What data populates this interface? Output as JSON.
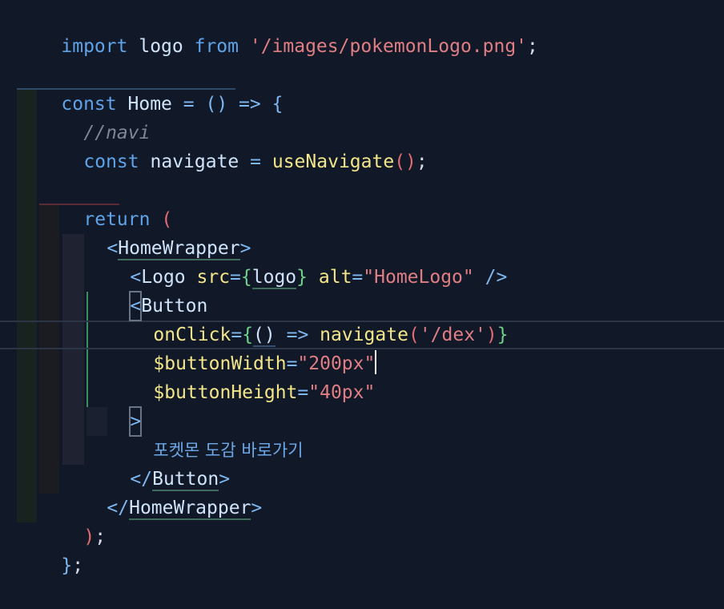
{
  "code": {
    "lines": [
      {
        "tokens": [
          [
            "kw",
            "import"
          ],
          [
            "plain",
            " "
          ],
          [
            "var",
            "logo"
          ],
          [
            "plain",
            " "
          ],
          [
            "kw",
            "from"
          ],
          [
            "plain",
            " "
          ],
          [
            "str",
            "'/images/pokemonLogo.png'"
          ],
          [
            "plain",
            ";"
          ]
        ]
      },
      {
        "tokens": [
          [
            "kw",
            "const"
          ],
          [
            "plain",
            " "
          ],
          [
            "var",
            "Home"
          ],
          [
            "plain",
            " "
          ],
          [
            "op",
            "="
          ],
          [
            "plain",
            " "
          ],
          [
            "paren",
            "()"
          ],
          [
            "plain",
            " "
          ],
          [
            "op",
            "=>"
          ],
          [
            "plain",
            " "
          ],
          [
            "brace",
            "{"
          ]
        ]
      },
      {
        "tokens": [
          [
            "comment",
            "//navi"
          ]
        ]
      },
      {
        "tokens": [
          [
            "kw",
            "const"
          ],
          [
            "plain",
            " "
          ],
          [
            "var",
            "navigate"
          ],
          [
            "plain",
            " "
          ],
          [
            "op",
            "="
          ],
          [
            "plain",
            " "
          ],
          [
            "fn",
            "useNavigate"
          ],
          [
            "paren",
            "()"
          ],
          [
            "plain",
            ";"
          ]
        ]
      },
      {
        "tokens": [
          [
            "kw",
            "return"
          ],
          [
            "plain",
            " "
          ],
          [
            "paren",
            "("
          ]
        ]
      },
      {
        "tokens": [
          [
            "punct",
            "<"
          ],
          [
            "tag",
            "HomeWrapper"
          ],
          [
            "punct",
            ">"
          ]
        ]
      },
      {
        "tokens": [
          [
            "punct",
            "<"
          ],
          [
            "tag",
            "Logo"
          ],
          [
            "plain",
            " "
          ],
          [
            "attr",
            "src"
          ],
          [
            "op",
            "="
          ],
          [
            "brace",
            "{"
          ],
          [
            "var",
            "logo"
          ],
          [
            "brace",
            "}"
          ],
          [
            "plain",
            " "
          ],
          [
            "attr",
            "alt"
          ],
          [
            "op",
            "="
          ],
          [
            "str",
            "\"HomeLogo\""
          ],
          [
            "plain",
            " "
          ],
          [
            "punct",
            "/>"
          ]
        ]
      },
      {
        "tokens": [
          [
            "punct",
            "<"
          ],
          [
            "tag",
            "Button"
          ]
        ]
      },
      {
        "tokens": [
          [
            "attr",
            "onClick"
          ],
          [
            "op",
            "="
          ],
          [
            "brace",
            "{"
          ],
          [
            "paren",
            "()"
          ],
          [
            "plain",
            " "
          ],
          [
            "op",
            "=>"
          ],
          [
            "plain",
            " "
          ],
          [
            "fn",
            "navigate"
          ],
          [
            "paren",
            "("
          ],
          [
            "str",
            "'/dex'"
          ],
          [
            "paren",
            ")"
          ],
          [
            "brace",
            "}"
          ]
        ]
      },
      {
        "tokens": [
          [
            "attr",
            "$buttonWidth"
          ],
          [
            "op",
            "="
          ],
          [
            "str",
            "\"200px\""
          ]
        ]
      },
      {
        "tokens": [
          [
            "attr",
            "$buttonHeight"
          ],
          [
            "op",
            "="
          ],
          [
            "str",
            "\"40px\""
          ]
        ]
      },
      {
        "tokens": [
          [
            "punct",
            ">"
          ]
        ]
      },
      {
        "tokens": [
          [
            "korean",
            "포켓몬 도감 바로가기"
          ]
        ]
      },
      {
        "tokens": [
          [
            "punct",
            "</"
          ],
          [
            "tag",
            "Button"
          ],
          [
            "punct",
            ">"
          ]
        ]
      },
      {
        "tokens": [
          [
            "punct",
            "</"
          ],
          [
            "tag",
            "HomeWrapper"
          ],
          [
            "punct",
            ">"
          ]
        ]
      },
      {
        "tokens": [
          [
            "paren",
            ")"
          ],
          [
            "plain",
            ";"
          ]
        ]
      },
      {
        "tokens": [
          [
            "brace",
            "}"
          ],
          [
            "plain",
            ";"
          ]
        ]
      }
    ]
  }
}
